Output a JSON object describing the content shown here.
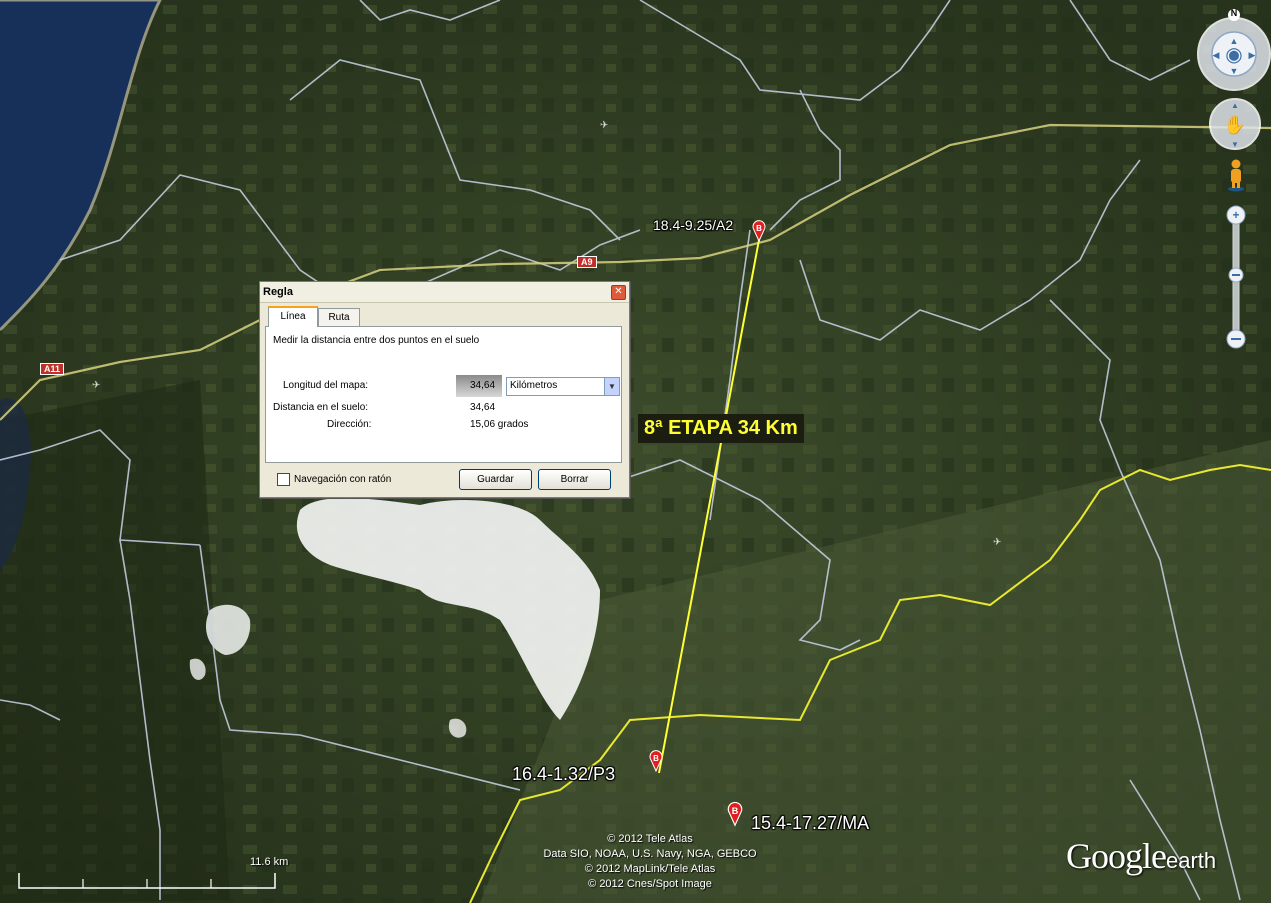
{
  "map": {
    "placemarks": [
      {
        "label": "18.4-9.25/A2"
      },
      {
        "label": "16.4-1.32/P3"
      },
      {
        "label": "15.4-17.27/MA"
      }
    ],
    "pin_letter": "B",
    "roads": [
      "A9",
      "A11"
    ],
    "stage_label": "8ª ETAPA 34 Km",
    "copyright": [
      "© 2012 Tele Atlas",
      "Data SIO, NOAA, U.S. Navy, NGA, GEBCO",
      "© 2012 MapLink/Tele Atlas",
      "© 2012 Cnes/Spot Image"
    ],
    "scale_label": "11.6 km",
    "logo_main": "Google",
    "logo_sub": "earth",
    "compass_letter": "N",
    "colors": {
      "measure_line": "#ffff33",
      "border_line": "#e8e830",
      "admin_border": "#c9d3e8",
      "pin": "#e02020"
    }
  },
  "dialog": {
    "title": "Regla",
    "close_glyph": "✕",
    "tabs": [
      {
        "label": "Línea",
        "active": true
      },
      {
        "label": "Ruta",
        "active": false
      }
    ],
    "description": "Medir la distancia entre dos puntos en el suelo",
    "map_length_label": "Longitud del mapa:",
    "map_length_value": "34,64",
    "unit_selected": "Kilómetros",
    "ground_distance_label": "Distancia en el suelo:",
    "ground_distance_value": "34,64",
    "direction_label": "Dirección:",
    "direction_value": "15,06 grados",
    "mouse_nav_label": "Navegación con ratón",
    "save_label": "Guardar",
    "clear_label": "Borrar"
  }
}
